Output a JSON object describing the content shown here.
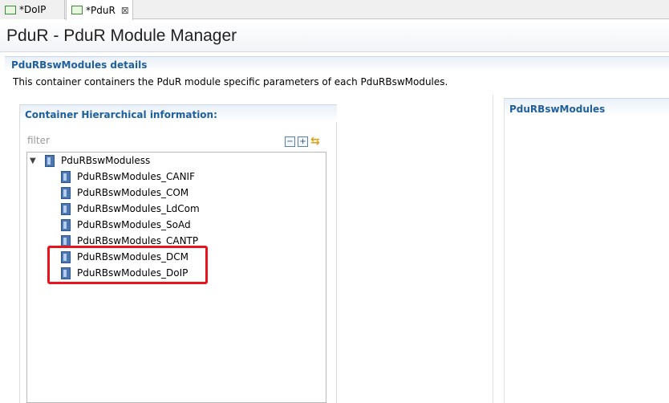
{
  "tabs": [
    {
      "label": "*DoIP"
    },
    {
      "label": "*PduR",
      "close": "⊠"
    }
  ],
  "editor": {
    "title": "PduR - PduR Module Manager"
  },
  "details": {
    "heading": "PduRBswModules details",
    "description": "This container containers the PduR module specific parameters of each PduRBswModules."
  },
  "hierarchy": {
    "heading": "Container Hierarchical information:",
    "filter_placeholder": "filter",
    "root": "PduRBswModuless",
    "children": [
      "PduRBswModules_CANIF",
      "PduRBswModules_COM",
      "PduRBswModules_LdCom",
      "PduRBswModules_SoAd",
      "PduRBswModules_CANTP",
      "PduRBswModules_DCM",
      "PduRBswModules_DoIP"
    ],
    "toolbar_icons": [
      "collapse-all-icon",
      "expand-all-icon",
      "sync-icon"
    ]
  },
  "right_panel": {
    "heading": "PduRBswModules"
  },
  "colors": {
    "section_heading": "#1f5f9e",
    "highlight_box": "#e8131b"
  }
}
